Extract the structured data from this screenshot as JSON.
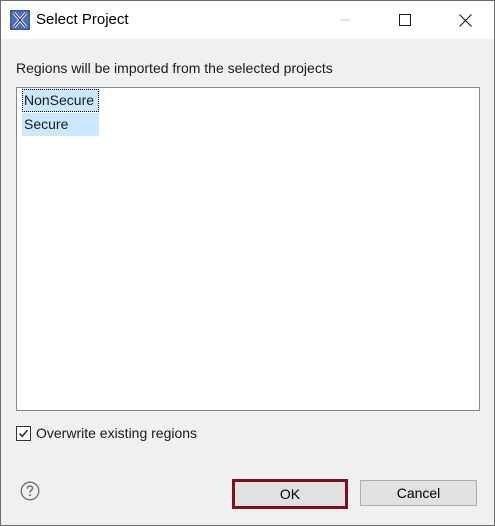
{
  "window": {
    "title": "Select Project",
    "app_icon": "x-app-icon",
    "controls": [
      "minimize-icon",
      "maximize-icon",
      "close-icon"
    ]
  },
  "dialog": {
    "prompt": "Regions will be imported from the selected projects",
    "projects": [
      {
        "label": "NonSecure",
        "selected": true
      },
      {
        "label": "Secure",
        "selected": true
      }
    ],
    "overwrite_checkbox": {
      "label": "Overwrite existing regions",
      "checked": true
    },
    "help_icon": "question-mark-icon",
    "ok_label": "OK",
    "cancel_label": "Cancel"
  },
  "colors": {
    "selection": "#cce8ff",
    "ok_border": "#7b1020",
    "app_icon_blue": "#3b5aa8"
  }
}
